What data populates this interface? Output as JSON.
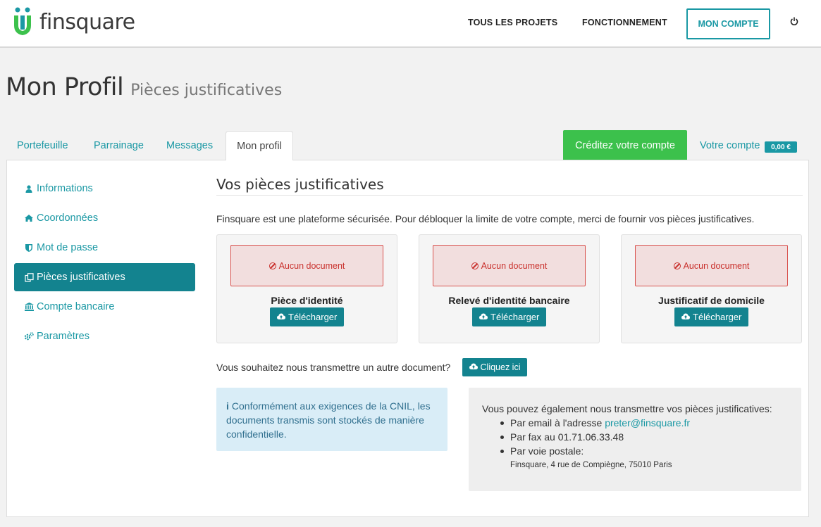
{
  "brand": {
    "name": "finsquare"
  },
  "nav": {
    "projects": "TOUS LES PROJETS",
    "how": "FONCTIONNEMENT",
    "account": "MON COMPTE",
    "power_icon": "power-icon"
  },
  "page": {
    "title": "Mon Profil",
    "subtitle": "Pièces justificatives"
  },
  "tabs": [
    {
      "label": "Portefeuille"
    },
    {
      "label": "Parrainage"
    },
    {
      "label": "Messages"
    },
    {
      "label": "Mon profil",
      "active": true
    }
  ],
  "credit_button": "Créditez votre compte",
  "account_link": {
    "label": "Votre compte",
    "balance": "0,00 €"
  },
  "sidebar": {
    "items": [
      {
        "label": "Informations",
        "icon": "user-icon"
      },
      {
        "label": "Coordonnées",
        "icon": "home-icon"
      },
      {
        "label": "Mot de passe",
        "icon": "shield-icon"
      },
      {
        "label": "Pièces justificatives",
        "icon": "files-icon",
        "active": true
      },
      {
        "label": "Compte bancaire",
        "icon": "bank-icon"
      },
      {
        "label": "Paramètres",
        "icon": "cogs-icon"
      }
    ]
  },
  "content": {
    "title": "Vos pièces justificatives",
    "intro": "Finsquare est une plateforme sécurisée. Pour débloquer la limite de votre compte, merci de fournir vos pièces justificatives.",
    "documents": [
      {
        "status": "Aucun document",
        "title": "Pièce d'identité",
        "button": "Télécharger"
      },
      {
        "status": "Aucun document",
        "title": "Relevé d'identité bancaire",
        "button": "Télécharger"
      },
      {
        "status": "Aucun document",
        "title": "Justificatif de domicile",
        "button": "Télécharger"
      }
    ],
    "other_question": "Vous souhaitez nous transmettre un autre document?",
    "other_button": "Cliquez ici",
    "info": "Conformément aux exigences de la CNIL, les documents transmis sont stockés de manière confidentielle.",
    "contact": {
      "intro": "Vous pouvez également nous transmettre vos pièces justificatives:",
      "email_prefix": "Par email à l'adresse ",
      "email": "preter@finsquare.fr",
      "fax": "Par fax au 01.71.06.33.48",
      "post": "Par voie postale:",
      "address": "Finsquare, 4 rue de Compiègne, 75010 Paris"
    }
  },
  "colors": {
    "accent": "#1a98a4",
    "accent_dark": "#13838f",
    "success": "#3cc14c",
    "danger": "#c9302c"
  }
}
